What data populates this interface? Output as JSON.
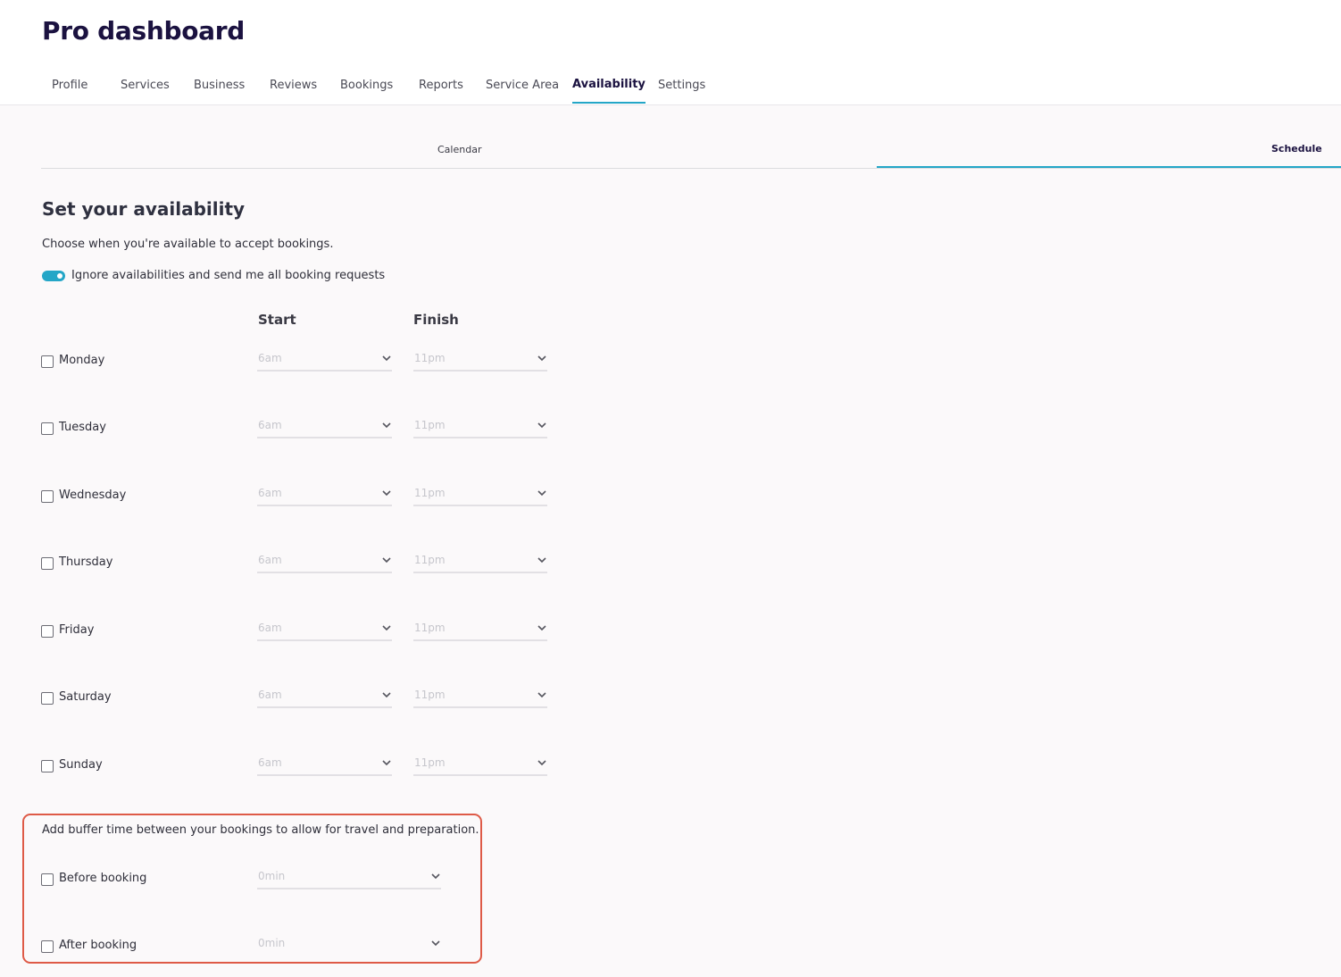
{
  "page_title": "Pro dashboard",
  "nav": {
    "tabs": [
      "Profile",
      "Services",
      "Business",
      "Reviews",
      "Bookings",
      "Reports",
      "Service Area",
      "Availability",
      "Settings"
    ],
    "active": "Availability"
  },
  "subtabs": {
    "calendar": "Calendar",
    "schedule": "Schedule",
    "active": "Schedule"
  },
  "availability": {
    "title": "Set your availability",
    "description": "Choose when you're available to accept bookings.",
    "toggle_label": "Ignore availabilities and send me all booking requests",
    "toggle_on": true,
    "start_header": "Start",
    "finish_header": "Finish",
    "days": [
      {
        "label": "Monday",
        "checked": false,
        "start": "6am",
        "finish": "11pm"
      },
      {
        "label": "Tuesday",
        "checked": false,
        "start": "6am",
        "finish": "11pm"
      },
      {
        "label": "Wednesday",
        "checked": false,
        "start": "6am",
        "finish": "11pm"
      },
      {
        "label": "Thursday",
        "checked": false,
        "start": "6am",
        "finish": "11pm"
      },
      {
        "label": "Friday",
        "checked": false,
        "start": "6am",
        "finish": "11pm"
      },
      {
        "label": "Saturday",
        "checked": false,
        "start": "6am",
        "finish": "11pm"
      },
      {
        "label": "Sunday",
        "checked": false,
        "start": "6am",
        "finish": "11pm"
      }
    ]
  },
  "buffer": {
    "description": "Add buffer time between your bookings to allow for travel and preparation.",
    "before": {
      "label": "Before booking",
      "checked": false,
      "value": "0min"
    },
    "after": {
      "label": "After booking",
      "checked": false,
      "value": "0min"
    }
  },
  "colors": {
    "accent": "#24a6c7",
    "title": "#1b1240",
    "highlight_border": "#de5a47"
  }
}
